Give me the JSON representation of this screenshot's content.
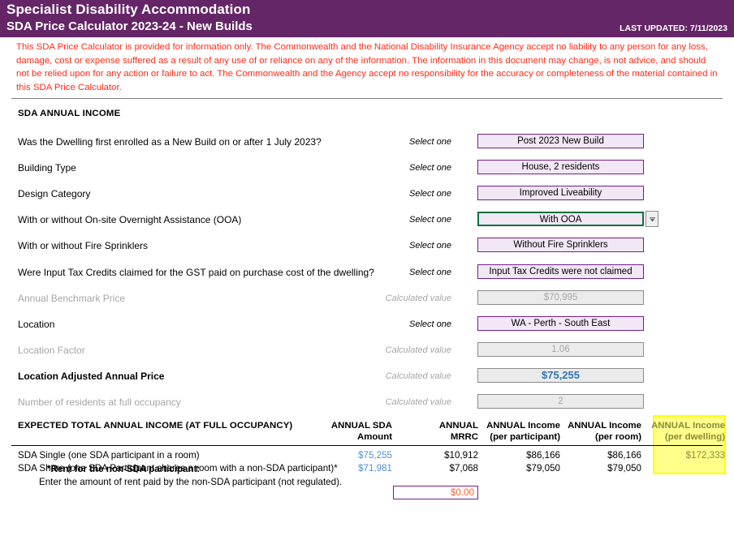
{
  "header": {
    "title": "Specialist Disability Accommodation",
    "subtitle": "SDA Price Calculator 2023-24 - New Builds",
    "last_updated": "LAST UPDATED: 7/11/2023",
    "bar_color": "#642667"
  },
  "disclaimer": {
    "text": "This SDA Price Calculator is provided for information only.  The Commonwealth and the National Disability Insurance Agency accept no liability to any person for any loss, damage, cost or expense suffered as a result of any use of or reliance on any of the information.  The information in this document may change, is not advice, and should not be relied upon for any action or failure to act. The Commonwealth and the Agency accept no responsibility for the accuracy or completeness of the material contained in this SDA Price Calculator.",
    "color": "#ff2a16"
  },
  "section": {
    "title": "SDA ANNUAL INCOME"
  },
  "hints": {
    "select_one": "Select one",
    "calculated_value": "Calculated value"
  },
  "rows": [
    {
      "label": "Was the Dwelling first enrolled as a New Build on or after 1 July 2023?",
      "hint": "Select one",
      "value": "Post 2023 New Build"
    },
    {
      "label": "Building Type",
      "hint": "Select one",
      "value": "House, 2 residents"
    },
    {
      "label": "Design Category",
      "hint": "Select one",
      "value": "Improved Liveability"
    },
    {
      "label": "With or without On-site Overnight Assistance (OOA)",
      "hint": "Select one",
      "value": "With OOA"
    },
    {
      "label": "With or without Fire Sprinklers",
      "hint": "Select one",
      "value": "Without Fire Sprinklers"
    },
    {
      "label": "Were Input Tax Credits claimed for the GST paid on purchase cost of the dwelling?",
      "hint": "Select one",
      "value": "Input Tax Credits were not claimed"
    },
    {
      "label": "Annual Benchmark Price",
      "hint": "Calculated value",
      "value": "$70,995"
    },
    {
      "label": "Location",
      "hint": "Select one",
      "value": "WA - Perth - South East"
    },
    {
      "label": "Location Factor",
      "hint": "Calculated value",
      "value": "1.06"
    },
    {
      "label": "Location Adjusted Annual Price",
      "hint": "Calculated value",
      "value": "$75,255"
    },
    {
      "label": "Number of residents at full occupancy",
      "hint": "Calculated value",
      "value": "2"
    }
  ],
  "results_table": {
    "title": "EXPECTED TOTAL ANNUAL INCOME (AT FULL OCCUPANCY)",
    "columns": [
      "ANNUAL SDA\nAmount",
      "ANNUAL\nMRRC",
      "ANNUAL Income\n(per participant)",
      "ANNUAL Income\n(per room)",
      "ANNUAL Income\n(per dwelling)"
    ],
    "col_sda_line1": "ANNUAL SDA",
    "col_sda_line2": "Amount",
    "col_mrrc_line1": "ANNUAL",
    "col_mrrc_line2": "MRRC",
    "col_part_line1": "ANNUAL Income",
    "col_part_line2": "(per participant)",
    "col_room_line1": "ANNUAL Income",
    "col_room_line2": "(per room)",
    "col_dwell_line1": "ANNUAL Income",
    "col_dwell_line2": "(per dwelling)",
    "rows": [
      {
        "label": "SDA Single (one SDA participant in a room)",
        "sda_amount": "$75,255",
        "mrrc": "$10,912",
        "per_participant": "$86,166",
        "per_room": "$86,166",
        "per_dwelling": "$172,333"
      },
      {
        "label": "SDA Share (one SDA Participant shares a room with a non-SDA participant)*",
        "sda_amount": "$71,981",
        "mrrc": "$7,068",
        "per_participant": "$79,050",
        "per_room": "$79,050",
        "per_dwelling": ""
      }
    ],
    "rent_note": "*Rent for the non-SDA participant:",
    "rent_sub": "Enter the amount of rent paid by the non-SDA participant (not regulated).",
    "rent_value": "$0.00",
    "highlight_color": "#ffff00"
  },
  "icons": {
    "dropdown": "chevron-down-icon"
  }
}
